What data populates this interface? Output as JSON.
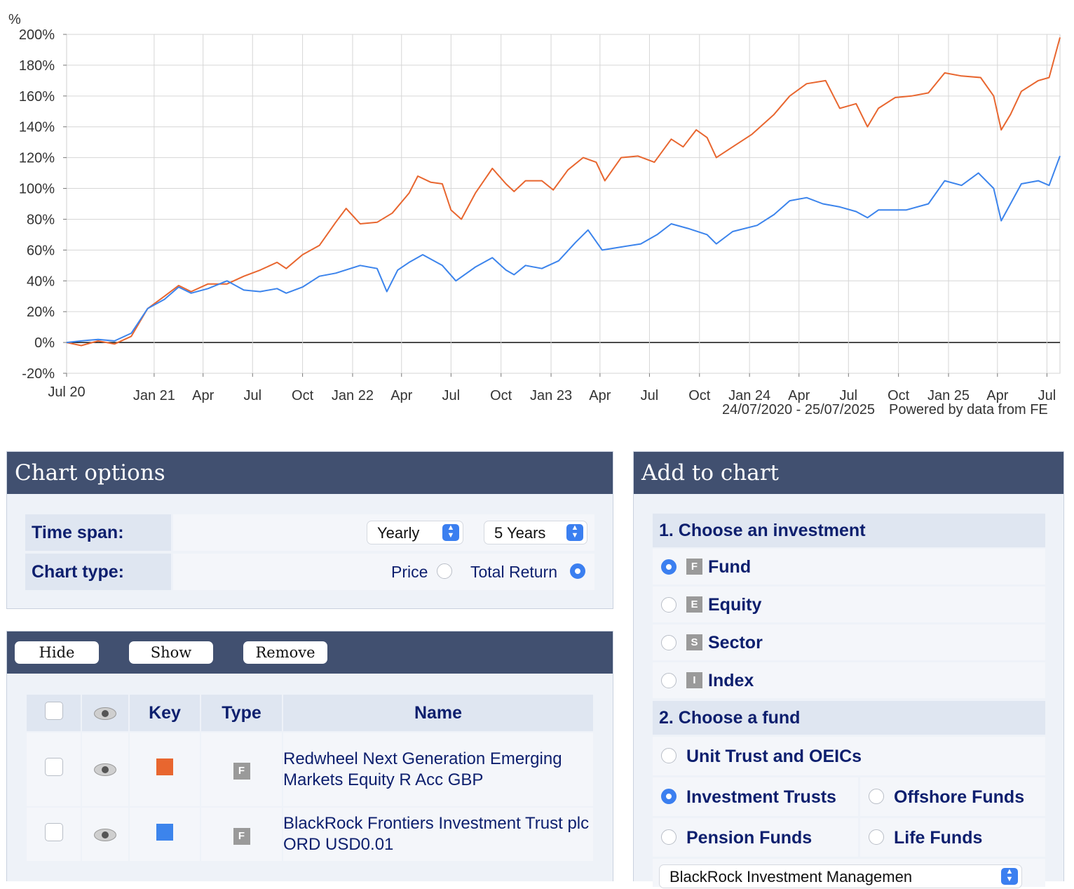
{
  "chart_data": {
    "type": "line",
    "yunit": "%",
    "ylim": [
      -20,
      200
    ],
    "yticks": [
      "200%",
      "180%",
      "160%",
      "140%",
      "120%",
      "100%",
      "80%",
      "60%",
      "40%",
      "20%",
      "0%",
      "-20%"
    ],
    "x_tick_labels": [
      "Jul 20",
      "Jan 21",
      "Apr",
      "Jul",
      "Oct",
      "Jan 22",
      "Apr",
      "Jul",
      "Oct",
      "Jan 23",
      "Apr",
      "Jul",
      "Oct",
      "Jan 24",
      "Apr",
      "Jul",
      "Oct",
      "Jan 25",
      "Apr",
      "Jul"
    ],
    "grid": true,
    "date_range": "24/07/2020 - 25/07/2025",
    "credit": "Powered by data from FE",
    "series": [
      {
        "color": "#e8662f",
        "points": [
          [
            "2020-07-24",
            0
          ],
          [
            "2020-08-20",
            -2
          ],
          [
            "2020-09-20",
            1
          ],
          [
            "2020-10-20",
            -1
          ],
          [
            "2020-11-20",
            4
          ],
          [
            "2020-12-20",
            22
          ],
          [
            "2021-01-20",
            30
          ],
          [
            "2021-02-15",
            37
          ],
          [
            "2021-03-10",
            33
          ],
          [
            "2021-04-10",
            38
          ],
          [
            "2021-05-15",
            38
          ],
          [
            "2021-06-15",
            43
          ],
          [
            "2021-07-15",
            47
          ],
          [
            "2021-08-15",
            52
          ],
          [
            "2021-09-01",
            48
          ],
          [
            "2021-10-01",
            57
          ],
          [
            "2021-11-01",
            63
          ],
          [
            "2021-12-01",
            78
          ],
          [
            "2021-12-20",
            87
          ],
          [
            "2022-01-15",
            77
          ],
          [
            "2022-02-15",
            78
          ],
          [
            "2022-03-15",
            84
          ],
          [
            "2022-04-15",
            97
          ],
          [
            "2022-05-01",
            108
          ],
          [
            "2022-05-25",
            104
          ],
          [
            "2022-06-15",
            103
          ],
          [
            "2022-07-01",
            86
          ],
          [
            "2022-07-20",
            80
          ],
          [
            "2022-08-15",
            97
          ],
          [
            "2022-09-15",
            113
          ],
          [
            "2022-10-10",
            103
          ],
          [
            "2022-10-25",
            98
          ],
          [
            "2022-11-15",
            105
          ],
          [
            "2022-12-15",
            105
          ],
          [
            "2023-01-05",
            99
          ],
          [
            "2023-02-01",
            112
          ],
          [
            "2023-03-01",
            120
          ],
          [
            "2023-03-25",
            117
          ],
          [
            "2023-04-10",
            105
          ],
          [
            "2023-05-10",
            120
          ],
          [
            "2023-06-10",
            121
          ],
          [
            "2023-07-10",
            117
          ],
          [
            "2023-08-10",
            132
          ],
          [
            "2023-09-01",
            127
          ],
          [
            "2023-09-25",
            138
          ],
          [
            "2023-10-15",
            133
          ],
          [
            "2023-11-01",
            120
          ],
          [
            "2023-12-01",
            127
          ],
          [
            "2024-01-05",
            135
          ],
          [
            "2024-02-15",
            148
          ],
          [
            "2024-03-15",
            160
          ],
          [
            "2024-04-15",
            168
          ],
          [
            "2024-05-20",
            170
          ],
          [
            "2024-06-15",
            152
          ],
          [
            "2024-07-15",
            155
          ],
          [
            "2024-08-05",
            140
          ],
          [
            "2024-08-25",
            152
          ],
          [
            "2024-09-25",
            159
          ],
          [
            "2024-10-25",
            160
          ],
          [
            "2024-11-25",
            162
          ],
          [
            "2024-12-25",
            175
          ],
          [
            "2025-01-25",
            173
          ],
          [
            "2025-03-01",
            172
          ],
          [
            "2025-03-25",
            160
          ],
          [
            "2025-04-08",
            138
          ],
          [
            "2025-04-25",
            148
          ],
          [
            "2025-05-15",
            163
          ],
          [
            "2025-06-15",
            170
          ],
          [
            "2025-07-05",
            172
          ],
          [
            "2025-07-25",
            198
          ]
        ]
      },
      {
        "color": "#3c84ec",
        "points": [
          [
            "2020-07-24",
            0
          ],
          [
            "2020-08-20",
            1
          ],
          [
            "2020-09-20",
            2
          ],
          [
            "2020-10-20",
            1
          ],
          [
            "2020-11-20",
            6
          ],
          [
            "2020-12-20",
            22
          ],
          [
            "2021-01-20",
            28
          ],
          [
            "2021-02-15",
            36
          ],
          [
            "2021-03-10",
            32
          ],
          [
            "2021-04-10",
            35
          ],
          [
            "2021-05-15",
            40
          ],
          [
            "2021-06-15",
            34
          ],
          [
            "2021-07-15",
            33
          ],
          [
            "2021-08-15",
            35
          ],
          [
            "2021-09-01",
            32
          ],
          [
            "2021-10-01",
            36
          ],
          [
            "2021-11-01",
            43
          ],
          [
            "2021-12-01",
            45
          ],
          [
            "2022-01-15",
            50
          ],
          [
            "2022-02-15",
            48
          ],
          [
            "2022-03-05",
            33
          ],
          [
            "2022-03-25",
            47
          ],
          [
            "2022-04-15",
            52
          ],
          [
            "2022-05-10",
            57
          ],
          [
            "2022-06-15",
            50
          ],
          [
            "2022-07-10",
            40
          ],
          [
            "2022-08-15",
            49
          ],
          [
            "2022-09-15",
            55
          ],
          [
            "2022-10-10",
            47
          ],
          [
            "2022-10-25",
            44
          ],
          [
            "2022-11-15",
            50
          ],
          [
            "2022-12-15",
            48
          ],
          [
            "2023-01-15",
            53
          ],
          [
            "2023-02-15",
            65
          ],
          [
            "2023-03-10",
            73
          ],
          [
            "2023-04-05",
            60
          ],
          [
            "2023-05-10",
            62
          ],
          [
            "2023-06-15",
            64
          ],
          [
            "2023-07-15",
            70
          ],
          [
            "2023-08-10",
            77
          ],
          [
            "2023-09-10",
            74
          ],
          [
            "2023-10-15",
            70
          ],
          [
            "2023-11-01",
            64
          ],
          [
            "2023-12-01",
            72
          ],
          [
            "2024-01-15",
            76
          ],
          [
            "2024-02-15",
            83
          ],
          [
            "2024-03-15",
            92
          ],
          [
            "2024-04-15",
            94
          ],
          [
            "2024-05-15",
            90
          ],
          [
            "2024-06-15",
            88
          ],
          [
            "2024-07-15",
            85
          ],
          [
            "2024-08-05",
            81
          ],
          [
            "2024-08-25",
            86
          ],
          [
            "2024-10-15",
            86
          ],
          [
            "2024-11-25",
            90
          ],
          [
            "2024-12-25",
            105
          ],
          [
            "2025-01-25",
            102
          ],
          [
            "2025-02-25",
            110
          ],
          [
            "2025-03-25",
            100
          ],
          [
            "2025-04-08",
            79
          ],
          [
            "2025-04-25",
            90
          ],
          [
            "2025-05-15",
            103
          ],
          [
            "2025-06-15",
            105
          ],
          [
            "2025-07-05",
            102
          ],
          [
            "2025-07-25",
            121
          ]
        ]
      }
    ]
  },
  "chart_options": {
    "title": "Chart options",
    "time_span_label": "Time span:",
    "time_span_frequency": "Yearly",
    "time_span_period": "5 Years",
    "chart_type_label": "Chart type:",
    "chart_type_options": [
      "Price",
      "Total Return"
    ],
    "chart_type_selected": "Total Return"
  },
  "series_list": {
    "buttons": {
      "hide": "Hide",
      "show": "Show",
      "remove": "Remove"
    },
    "headers": {
      "key": "Key",
      "type": "Type",
      "name": "Name"
    },
    "rows": [
      {
        "key_color": "#e8662f",
        "type_badge": "F",
        "name": "Redwheel Next Generation Emerging Markets Equity R Acc GBP"
      },
      {
        "key_color": "#3c84ec",
        "type_badge": "F",
        "name": "BlackRock Frontiers Investment Trust plc ORD USD0.01"
      }
    ]
  },
  "add_to_chart": {
    "title": "Add to chart",
    "step1": "1. Choose an investment",
    "investments": [
      {
        "badge": "F",
        "label": "Fund",
        "selected": true
      },
      {
        "badge": "E",
        "label": "Equity",
        "selected": false
      },
      {
        "badge": "S",
        "label": "Sector",
        "selected": false
      },
      {
        "badge": "I",
        "label": "Index",
        "selected": false
      }
    ],
    "step2": "2. Choose a fund",
    "fund_types": {
      "unit_trust": "Unit Trust and OEICs",
      "investment_trusts": "Investment Trusts",
      "offshore": "Offshore Funds",
      "pension": "Pension Funds",
      "life": "Life Funds",
      "selected": "Investment Trusts"
    },
    "manager_select": "BlackRock Investment Managemen"
  }
}
